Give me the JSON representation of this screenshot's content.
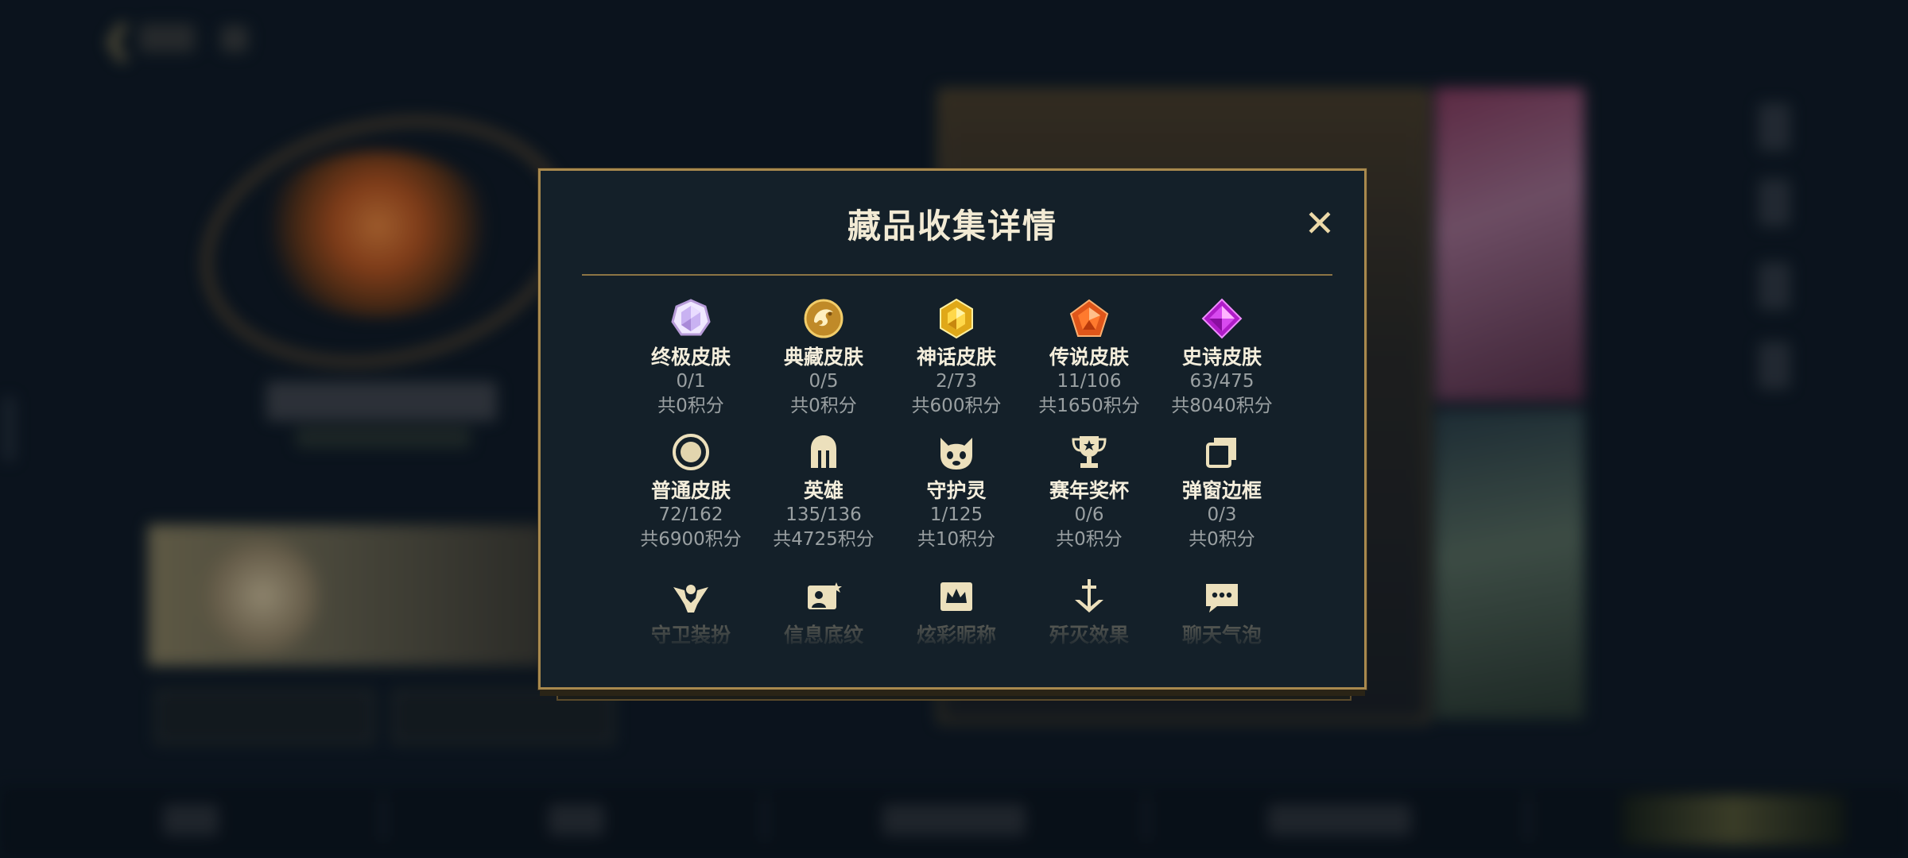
{
  "modal": {
    "title": "藏品收集详情",
    "close_symbol": "✕",
    "items": [
      {
        "icon": "ultimate-skin-icon",
        "label": "终极皮肤",
        "count": "0/1",
        "points": "共0积分"
      },
      {
        "icon": "collector-skin-icon",
        "label": "典藏皮肤",
        "count": "0/5",
        "points": "共0积分"
      },
      {
        "icon": "mythic-skin-icon",
        "label": "神话皮肤",
        "count": "2/73",
        "points": "共600积分"
      },
      {
        "icon": "legendary-skin-icon",
        "label": "传说皮肤",
        "count": "11/106",
        "points": "共1650积分"
      },
      {
        "icon": "epic-skin-icon",
        "label": "史诗皮肤",
        "count": "63/475",
        "points": "共8040积分"
      },
      {
        "icon": "normal-skin-icon",
        "label": "普通皮肤",
        "count": "72/162",
        "points": "共6900积分"
      },
      {
        "icon": "hero-helmet-icon",
        "label": "英雄",
        "count": "135/136",
        "points": "共4725积分"
      },
      {
        "icon": "guardian-spirit-icon",
        "label": "守护灵",
        "count": "1/125",
        "points": "共10积分"
      },
      {
        "icon": "season-trophy-icon",
        "label": "赛年奖杯",
        "count": "0/6",
        "points": "共0积分"
      },
      {
        "icon": "popup-frame-icon",
        "label": "弹窗边框",
        "count": "0/3",
        "points": "共0积分"
      },
      {
        "icon": "guardian-outfit-icon",
        "label": "守卫装扮"
      },
      {
        "icon": "info-card-pattern-icon",
        "label": "信息底纹"
      },
      {
        "icon": "colorful-nickname-icon",
        "label": "炫彩昵称"
      },
      {
        "icon": "kill-effect-icon",
        "label": "歼灭效果"
      },
      {
        "icon": "chat-bubble-icon",
        "label": "聊天气泡"
      }
    ]
  },
  "colors": {
    "modal_bg": "#142029",
    "modal_border": "#a8894e",
    "title": "#f2ead4",
    "label": "#f4eedc",
    "muted_text": "#9aa0a2",
    "icon_gold": "#e9cf92"
  }
}
